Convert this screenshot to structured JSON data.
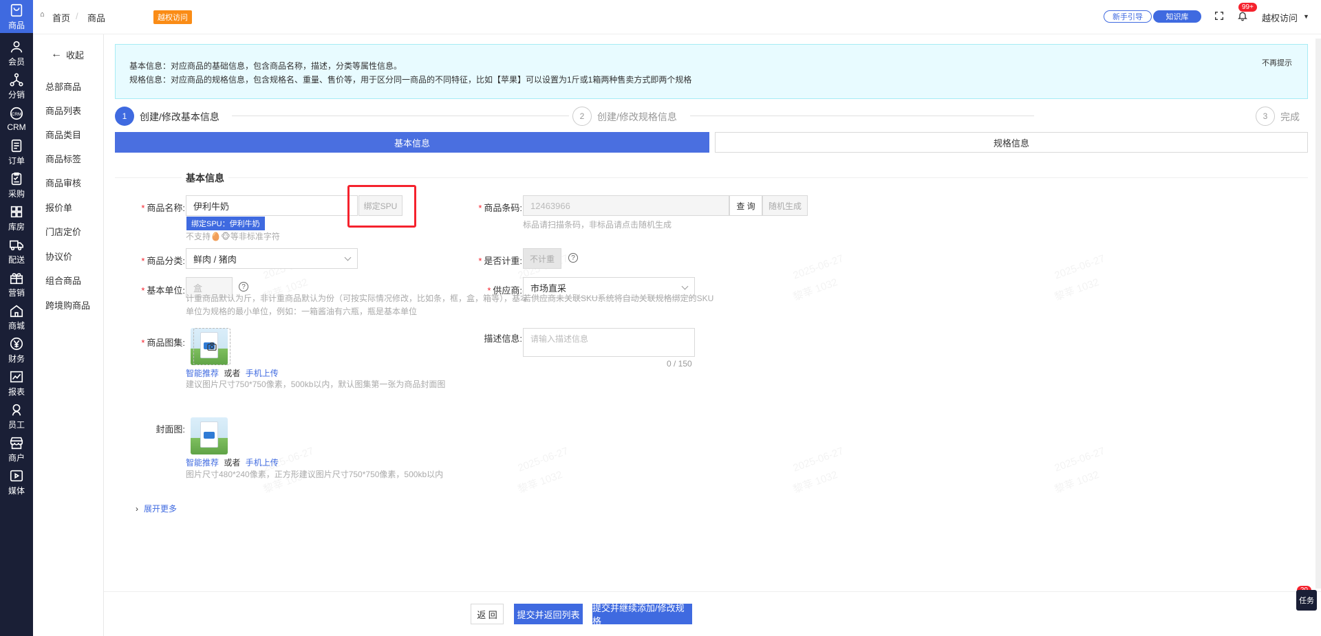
{
  "rail": {
    "items": [
      {
        "label": "商品",
        "icon": "bag-icon"
      },
      {
        "label": "会员",
        "icon": "user-icon"
      },
      {
        "label": "分销",
        "icon": "share-tree-icon"
      },
      {
        "label": "CRM",
        "icon": "crm-icon"
      },
      {
        "label": "订单",
        "icon": "order-list-icon"
      },
      {
        "label": "采购",
        "icon": "purchase-icon"
      },
      {
        "label": "库房",
        "icon": "warehouse-grid-icon"
      },
      {
        "label": "配送",
        "icon": "truck-icon"
      },
      {
        "label": "营销",
        "icon": "gift-icon"
      },
      {
        "label": "商城",
        "icon": "home-icon"
      },
      {
        "label": "财务",
        "icon": "yen-icon"
      },
      {
        "label": "报表",
        "icon": "chart-icon"
      },
      {
        "label": "员工",
        "icon": "staff-icon"
      },
      {
        "label": "商户",
        "icon": "shop-icon"
      },
      {
        "label": "媒体",
        "icon": "media-icon"
      }
    ]
  },
  "submenu": {
    "collapse_label": "收起",
    "items": [
      "总部商品",
      "商品列表",
      "商品类目",
      "商品标签",
      "商品审核",
      "报价单",
      "门店定价",
      "协议价",
      "组合商品",
      "跨境购商品"
    ]
  },
  "header": {
    "breadcrumb_home": "首页",
    "breadcrumb_sep": "/",
    "breadcrumb_current": "商品",
    "access_tag": "越权访问",
    "guide_pill": "新手引导",
    "knowledge_pill": "知识库",
    "bell_badge": "99+",
    "user_name": "越权访问"
  },
  "tip": {
    "line1": "基本信息：对应商品的基础信息，包含商品名称，描述，分类等属性信息。",
    "line2": "规格信息：对应商品的规格信息，包含规格名、重量、售价等，用于区分同一商品的不同特征，比如【苹果】可以设置为1斤或1箱两种售卖方式即两个规格",
    "dismiss": "不再提示"
  },
  "steps": [
    {
      "num": "1",
      "label": "创建/修改基本信息"
    },
    {
      "num": "2",
      "label": "创建/修改规格信息"
    },
    {
      "num": "3",
      "label": "完成"
    }
  ],
  "tabs": {
    "basic": "基本信息",
    "spec": "规格信息"
  },
  "section_title": "基本信息",
  "form": {
    "name_label": "商品名称:",
    "name_value": "伊利牛奶",
    "bind_spu_button": "绑定SPU",
    "spu_tag": "绑定SPU：伊利牛奶",
    "name_hint": "不支持🥚🐵等非标准字符",
    "barcode_label": "商品条码:",
    "barcode_value": "12463966",
    "query_button": "查 询",
    "random_button": "随机生成",
    "barcode_hint": "标品请扫描条码，非标品请点击随机生成",
    "category_label": "商品分类:",
    "category_value": "鲜肉 / 猪肉",
    "weigh_label": "是否计重:",
    "weigh_value": "不计重",
    "unit_label": "基本单位:",
    "unit_value": "盒",
    "unit_hint1": "计重商品默认为斤，非计重商品默认为份（可按实际情况修改，比如条，框，盒，箱等），基本",
    "unit_hint2": "单位为规格的最小单位，例如：一箱酱油有六瓶，瓶是基本单位",
    "supplier_label": "供应商:",
    "supplier_value": "市场直采",
    "supplier_hint": "若供应商未关联SKU系统将自动关联规格绑定的SKU",
    "gallery_label": "商品图集:",
    "smart_recommend": "智能推荐",
    "or_text": "或者",
    "mobile_upload": "手机上传",
    "gallery_hint": "建议图片尺寸750*750像素，500kb以内，默认图集第一张为商品封面图",
    "desc_label": "描述信息:",
    "desc_placeholder": "请输入描述信息",
    "desc_counter": "0 / 150",
    "cover_label": "封面图:",
    "cover_hint": "图片尺寸480*240像素，正方形建议图片尺寸750*750像素，500kb以内",
    "expand_more": "展开更多"
  },
  "footer": {
    "back": "返 回",
    "submit_return": "提交并返回列表",
    "submit_continue": "提交并继续添加/修改规格"
  },
  "watermark": {
    "date": "2025-06-27",
    "name": "黎莘 1032"
  },
  "task": {
    "label": "任务",
    "badge": "20"
  },
  "colors": {
    "primary": "#3f6ae0",
    "rail_bg": "#1a1f36",
    "danger": "#f5222d",
    "warning": "#fa8c16"
  }
}
